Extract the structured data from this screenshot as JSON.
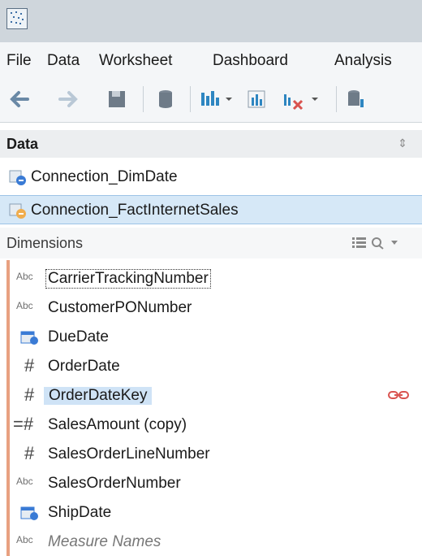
{
  "menu": {
    "file": "File",
    "data": "Data",
    "worksheet": "Worksheet",
    "dashboard": "Dashboard",
    "analysis": "Analysis"
  },
  "data_pane": {
    "title": "Data",
    "connections": [
      {
        "label": "Connection_DimDate",
        "selected": false
      },
      {
        "label": "Connection_FactInternetSales",
        "selected": true
      }
    ]
  },
  "dimensions": {
    "title": "Dimensions",
    "fields": [
      {
        "type": "Abc",
        "label": "CarrierTrackingNumber"
      },
      {
        "type": "Abc",
        "label": "CustomerPONumber"
      },
      {
        "type": "date",
        "label": "DueDate"
      },
      {
        "type": "#",
        "label": "OrderDate"
      },
      {
        "type": "#",
        "label": "OrderDateKey"
      },
      {
        "type": "=#",
        "label": "SalesAmount (copy)"
      },
      {
        "type": "#",
        "label": "SalesOrderLineNumber"
      },
      {
        "type": "Abc",
        "label": "SalesOrderNumber"
      },
      {
        "type": "date",
        "label": "ShipDate"
      },
      {
        "type": "Abc",
        "label": "Measure Names"
      }
    ]
  },
  "colors": {
    "titlebar": "#cfd6dc",
    "selection": "#d6e8f7",
    "field_highlight": "#cfe3f6",
    "accent_bar": "#e8a080",
    "link_icon": "#d9534f"
  },
  "icons": {
    "sort": "sort-icon",
    "list_view": "list-view-icon",
    "search": "search-icon",
    "dropdown": "chevron-down-icon",
    "link": "link-icon"
  }
}
